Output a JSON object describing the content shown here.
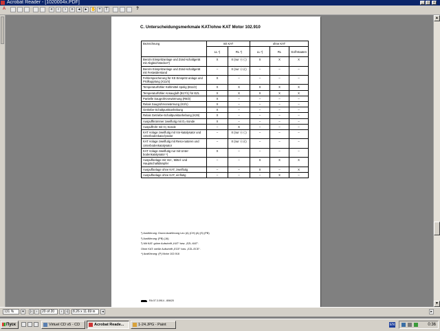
{
  "window": {
    "title": "Acrobat Reader - [1020004x.PDF]"
  },
  "menu": {
    "app_letter": "A"
  },
  "toolbar": {
    "help_label": "?"
  },
  "document": {
    "heading": "C.  Unterscheidungsmerkmale KAT/ohne KAT Motor 102.910",
    "table": {
      "col_bez": "Bezeichnung",
      "col_mit": "mit KAT",
      "col_ohne": "ohne KAT",
      "sub": [
        "LL ¹)",
        "RL ²)",
        "LL ²)",
        "RL",
        "Golf-staaten"
      ],
      "rows": [
        {
          "label": "Benzin Einspritzanlage und Zünd-schaltgerät mit Abgleichstecker³)",
          "cells": [
            "X",
            "X (nur ⓔⓒ)",
            "X",
            "X",
            "X"
          ]
        },
        {
          "label": "Benzin Einspritzanlage und Zünd-schaltgerät mit Festwiderstand",
          "cells": [
            "–",
            "X (nur ⓔⓓ)",
            "–",
            "–",
            "–"
          ]
        },
        {
          "label": "Fehlerspeicherung für KE Einspritz-anlage und Prüfkupplung (X11/4)",
          "cells": [
            "X",
            "–",
            "–",
            "–",
            "–"
          ]
        },
        {
          "label": "Temperaturfühler Kühlmittel 4polig (B11/2)",
          "cells": [
            "X",
            "X",
            "X",
            "X",
            "X"
          ]
        },
        {
          "label": "Temperaturfühler Ansaugluft (B17/1) für EZL",
          "cells": [
            "X",
            "X",
            "X",
            "X",
            "X"
          ]
        },
        {
          "label": "Partielle Saugrohrvorwärmung (R8/2)",
          "cells": [
            "X",
            "–",
            "–",
            "–",
            "–"
          ]
        },
        {
          "label": "Relais Saugrohrvorwärmung (K3/1)",
          "cells": [
            "X",
            "–",
            "–",
            "–",
            "–"
          ]
        },
        {
          "label": "Getriebe-Schaltpunktanhebung",
          "cells": [
            "X",
            "–",
            "–",
            "–",
            "–"
          ]
        },
        {
          "label": "Relais Getriebe-Schaltpunktanhebung (K29)",
          "cells": [
            "X",
            "–",
            "–",
            "–",
            "–"
          ]
        },
        {
          "label": "Auspuffkrümmer zweiflutig mit O₂-Sonde",
          "cells": [
            "X",
            "–",
            "–",
            "–",
            "–"
          ]
        },
        {
          "label": "Auspuffrohr mit O₂-Sonde",
          "cells": [
            "–",
            "X",
            "–",
            "–",
            "–"
          ]
        },
        {
          "label": "KAT Anlage zweiflutig mit Vor-katalysator und Unterbodenkata-lysator",
          "cells": [
            "–",
            "X (nur ⓔⓒ)",
            "–",
            "–",
            "–"
          ]
        },
        {
          "label": "KAT Anlage zweiflutig mit Reso-natoren und Unterbodenkatalysator",
          "cells": [
            "–",
            "X (nur ⓔⓓ)",
            "–",
            "–",
            "–"
          ]
        },
        {
          "label": "KAT Anlage zweiflutig nur mit Unter-bodenkatalysator ⁵)",
          "cells": [
            "X",
            "–",
            "–",
            "–",
            "–"
          ]
        },
        {
          "label": "Auspuffanlage mit Vor-, Mittel- und Hauptschalldämpfer",
          "cells": [
            "–",
            "–",
            "X",
            "X",
            "X"
          ]
        },
        {
          "label": "Auspuffanlage ohne KAT, zweiflutig",
          "cells": [
            "–",
            "–",
            "X",
            "–",
            "X"
          ]
        },
        {
          "label": "Auspuffanlage ohne KAT, einflutig",
          "cells": [
            "–",
            "–",
            "–",
            "X",
            "–"
          ]
        }
      ]
    },
    "notes": [
      "¹)   Ausführung: Grund-Ausführung Leo (A) (CH) (A) (S) (PB)",
      "²)   Ausführung: (PB) (JA)",
      "³)   Mit KAT:      grüne Aufschrift „KAT“ bzw. „EZL-KAT“.",
      "       Ohne KAT:    weiße Aufschrift „ECE“ bzw. „EZL-ECE“.",
      "⁴)   Ausführung: (P) Motor 102.918"
    ],
    "footer": "RA 07.3.0914 - 806/20"
  },
  "statusbar": {
    "zoom": "131 %",
    "page": "20 of 20",
    "size": "8.26 x 11.69 in"
  },
  "taskbar": {
    "start_label": "Пуск",
    "tasks": [
      "Virtuel CD v5 - CD",
      "Acrobat Reade...",
      "1-24.JPG - Paint"
    ],
    "lang": "EN",
    "clock": "0:36"
  },
  "colors": {
    "titlebar": "#0a246a",
    "chrome": "#d4d0c8",
    "workspace": "#808080"
  }
}
